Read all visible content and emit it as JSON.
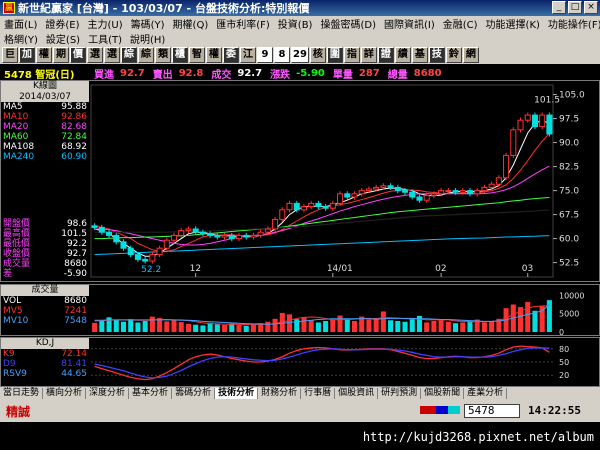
{
  "window": {
    "title": "新世紀贏家 [台灣] - 103/03/07 - 台盤技術分析:特別報價"
  },
  "menu": {
    "row1": [
      "畫面(L)",
      "證券(E)",
      "主力(U)",
      "籌碼(Y)",
      "期權(Q)",
      "匯市利率(F)",
      "投資(B)",
      "操盤密碼(D)",
      "國際資訊(I)",
      "金融(C)",
      "功能選擇(K)",
      "功能操作(F)"
    ],
    "row2": [
      "格網(Y)",
      "設定(S)",
      "工具(T)",
      "說明(H)"
    ]
  },
  "toolbar": [
    "巨",
    "加",
    "權",
    "期",
    "價",
    "選",
    "選",
    "綜",
    "綜",
    "類",
    "櫃",
    "智",
    "權",
    "委",
    "江",
    "9",
    "8",
    "29",
    "核",
    "圍",
    "指",
    "詳",
    "證",
    "績",
    "基",
    "技",
    "鈴",
    "網"
  ],
  "quote": {
    "code": "5478 智冠(日)",
    "buy_label": "買進",
    "buy_value": "92.7",
    "sell_label": "賣出",
    "sell_value": "92.8",
    "deal_label": "成交",
    "deal_value": "92.7",
    "change_label": "漲跌",
    "change_value": "-5.90",
    "volume_label": "單量",
    "volume_value": "287",
    "total_label": "總量",
    "total_value": "8680"
  },
  "kline_legend": {
    "title": "K線圖",
    "date": "2014/03/07",
    "ma": [
      {
        "name": "MA5",
        "value": "95.88"
      },
      {
        "name": "MA10",
        "value": "92.86"
      },
      {
        "name": "MA20",
        "value": "82.68"
      },
      {
        "name": "MA60",
        "value": "72.84"
      },
      {
        "name": "MA108",
        "value": "68.92"
      },
      {
        "name": "MA240",
        "value": "60.90"
      }
    ],
    "stats": [
      {
        "name": "開盤價",
        "value": "98.6"
      },
      {
        "name": "最高價",
        "value": "101.5"
      },
      {
        "name": "最低價",
        "value": "92.2"
      },
      {
        "name": "收盤價",
        "value": "92.7"
      },
      {
        "name": "成交量",
        "value": "8680"
      },
      {
        "name": "差",
        "value": "-5.90"
      }
    ]
  },
  "volume_legend": {
    "title": "成交量",
    "rows": [
      {
        "name": "VOL",
        "value": "8680"
      },
      {
        "name": "MV5",
        "value": "7241"
      },
      {
        "name": "MV10",
        "value": "7548"
      }
    ]
  },
  "kd_legend": {
    "title": "KD,J",
    "rows": [
      {
        "name": "K9",
        "value": "72.14"
      },
      {
        "name": "D9",
        "value": "81.41"
      },
      {
        "name": "RSV9",
        "value": "44.65"
      }
    ]
  },
  "bottom_tabs": [
    "當日走勢",
    "橫向分析",
    "深度分析",
    "基本分析",
    "籌碼分析",
    "技術分析",
    "財務分析",
    "行事曆",
    "個股資訊",
    "研判預測",
    "個股新聞",
    "產業分析"
  ],
  "status": {
    "mode": "精誠",
    "code": "5478",
    "clock": "14:22:55"
  },
  "url": "http://kujd3268.pixnet.net/album",
  "colors": {
    "up": "#ff3030",
    "down": "#00e0e0",
    "ma5": "#ffffff",
    "ma10": "#ff3030",
    "ma20": "#c040ff",
    "ma60": "#40ff40",
    "ma240": "#00c0ff",
    "k": "#ff3030",
    "d": "#4040ff"
  },
  "chart_data": [
    {
      "type": "candlestick",
      "title": "K線圖",
      "x_ticks": [
        "12",
        "14/01",
        "02",
        "03"
      ],
      "y_ticks": [
        105.0,
        97.5,
        90.0,
        82.5,
        75.0,
        67.5,
        60.0,
        52.5
      ],
      "ylim": [
        48,
        108
      ],
      "annotations": [
        {
          "label": "101.5"
        },
        {
          "label": "52.2"
        }
      ],
      "closes": [
        63.5,
        62,
        61,
        59,
        57,
        55,
        53.5,
        53,
        55,
        57,
        59.5,
        61,
        62.5,
        63,
        62,
        61.5,
        61,
        60.5,
        61,
        60,
        61,
        60.5,
        61,
        62,
        63,
        66,
        69,
        71,
        69,
        70,
        71,
        70,
        69.5,
        71,
        74,
        73,
        74,
        75,
        75.5,
        76,
        76.5,
        76,
        75,
        74.5,
        73,
        72,
        73.5,
        74,
        75,
        75,
        74.5,
        75,
        74,
        75,
        76,
        77,
        79,
        86,
        94,
        97,
        98.6,
        95,
        98.6,
        92.7
      ],
      "opens": [
        64,
        63.5,
        62,
        61,
        59,
        57,
        55,
        53.5,
        53,
        55,
        57,
        59.5,
        61,
        62.5,
        63,
        62,
        61.5,
        61,
        60.5,
        61,
        60,
        61,
        60.5,
        61,
        62,
        63,
        66,
        69,
        71,
        69,
        70,
        71,
        70,
        69.5,
        71,
        74,
        73,
        74,
        75,
        75.5,
        76,
        76.5,
        76,
        75,
        74.5,
        73,
        72,
        73.5,
        74,
        75,
        75,
        74.5,
        75,
        74,
        75,
        76,
        77,
        79,
        86,
        94,
        97,
        98.6,
        95,
        98.6
      ],
      "series": [
        {
          "name": "MA5",
          "values": [
            63,
            62.5,
            61.5,
            60,
            58.5,
            57,
            55.5,
            54.5,
            54.5,
            55.5,
            57,
            58.5,
            60,
            61.5,
            62,
            62,
            61.5,
            61,
            61,
            60.8,
            60.6,
            60.6,
            60.6,
            61,
            61.6,
            63,
            65,
            67.5,
            69,
            70,
            70,
            70.2,
            70,
            70.5,
            71.2,
            72,
            73,
            74,
            74.5,
            75,
            75.5,
            75.8,
            75.7,
            75.4,
            75,
            74,
            73.5,
            73.4,
            73.6,
            74.2,
            74.6,
            74.8,
            74.7,
            74.7,
            75,
            75.5,
            76.6,
            79,
            83,
            88,
            93,
            96,
            97,
            95.88
          ]
        },
        {
          "name": "MA10",
          "values": [
            64,
            63.5,
            63,
            62,
            61,
            60,
            58.5,
            57.5,
            56.5,
            56,
            56,
            56.5,
            57.5,
            58.5,
            59.5,
            60.5,
            61,
            61,
            61.2,
            61.2,
            61,
            60.8,
            60.8,
            61,
            61.2,
            61.8,
            62.8,
            64.2,
            65.5,
            66.8,
            68,
            69,
            69.8,
            70.2,
            70.6,
            71,
            71.6,
            72.2,
            72.8,
            73.5,
            74.2,
            74.8,
            75,
            75.2,
            75.2,
            75,
            74.6,
            74.4,
            74.2,
            74.1,
            74.1,
            74.2,
            74.2,
            74.3,
            74.6,
            75,
            75.7,
            76.8,
            78.8,
            81.4,
            84.4,
            87.6,
            90.4,
            92.86
          ]
        },
        {
          "name": "MA20",
          "values": [
            63,
            63,
            62.8,
            62.5,
            62,
            61.5,
            61,
            60.5,
            60,
            59.5,
            59,
            58.5,
            58.2,
            58,
            58,
            58.2,
            58.5,
            59,
            59.5,
            60,
            60.5,
            60.8,
            61,
            61.2,
            61.5,
            62,
            62.5,
            63.2,
            64,
            64.8,
            65.5,
            66.2,
            67,
            67.8,
            68.6,
            69.3,
            70,
            70.6,
            71.2,
            71.8,
            72.3,
            72.8,
            73.2,
            73.5,
            73.8,
            74,
            74,
            74,
            74,
            74,
            74,
            74,
            74,
            74,
            74.1,
            74.3,
            74.7,
            75.3,
            76.2,
            77.4,
            78.8,
            80.2,
            81.5,
            82.68
          ]
        },
        {
          "name": "MA60",
          "values": [
            60,
            60,
            60.1,
            60.2,
            60.3,
            60.3,
            60.4,
            60.5,
            60.5,
            60.6,
            60.7,
            60.8,
            60.9,
            61,
            61.2,
            61.4,
            61.6,
            61.8,
            62,
            62.2,
            62.4,
            62.6,
            62.8,
            63,
            63.2,
            63.4,
            63.6,
            63.9,
            64.2,
            64.5,
            64.8,
            65.1,
            65.4,
            65.7,
            66,
            66.3,
            66.6,
            66.9,
            67.2,
            67.5,
            67.8,
            68.1,
            68.4,
            68.6,
            68.8,
            69,
            69.2,
            69.4,
            69.6,
            69.8,
            70,
            70.2,
            70.4,
            70.6,
            70.8,
            71,
            71.2,
            71.5,
            71.8,
            72,
            72.3,
            72.5,
            72.7,
            72.84
          ]
        },
        {
          "name": "MA108",
          "values": [
            62,
            62,
            62,
            62,
            62,
            62,
            62,
            62,
            62,
            62,
            62,
            62.1,
            62.1,
            62.2,
            62.2,
            62.3,
            62.4,
            62.5,
            62.6,
            62.7,
            62.8,
            62.9,
            63,
            63.1,
            63.2,
            63.3,
            63.4,
            63.5,
            63.6,
            63.8,
            64,
            64.2,
            64.4,
            64.6,
            64.8,
            65,
            65.2,
            65.4,
            65.6,
            65.8,
            66,
            66.2,
            66.4,
            66.6,
            66.8,
            67,
            67.1,
            67.2,
            67.3,
            67.4,
            67.5,
            67.6,
            67.7,
            67.8,
            67.9,
            68,
            68.1,
            68.2,
            68.3,
            68.4,
            68.5,
            68.6,
            68.8,
            68.92
          ]
        },
        {
          "name": "MA240",
          "values": [
            55,
            55.1,
            55.2,
            55.3,
            55.4,
            55.5,
            55.6,
            55.7,
            55.8,
            55.9,
            56,
            56.1,
            56.2,
            56.3,
            56.4,
            56.5,
            56.6,
            56.7,
            56.8,
            56.9,
            57,
            57.1,
            57.2,
            57.3,
            57.4,
            57.5,
            57.6,
            57.7,
            57.8,
            57.9,
            58,
            58.1,
            58.2,
            58.3,
            58.4,
            58.5,
            58.6,
            58.7,
            58.8,
            58.9,
            59,
            59.1,
            59.2,
            59.3,
            59.4,
            59.5,
            59.6,
            59.7,
            59.8,
            59.9,
            60,
            60.05,
            60.1,
            60.15,
            60.2,
            60.3,
            60.4,
            60.5,
            60.55,
            60.6,
            60.7,
            60.75,
            60.85,
            60.9
          ]
        }
      ]
    },
    {
      "type": "bar",
      "title": "成交量",
      "y_ticks": [
        10000,
        5000,
        0
      ],
      "ylim": [
        0,
        12000
      ],
      "values": [
        2500,
        3000,
        4000,
        3200,
        2800,
        3500,
        2600,
        3000,
        4200,
        3800,
        2900,
        3300,
        2700,
        2200,
        2000,
        1800,
        2500,
        2100,
        1900,
        2300,
        2000,
        1700,
        1900,
        2400,
        2800,
        3600,
        5200,
        4800,
        3500,
        4000,
        3200,
        2600,
        3000,
        3400,
        4500,
        3600,
        3000,
        4200,
        3400,
        3800,
        5600,
        3200,
        3000,
        2800,
        3500,
        4400,
        2600,
        3000,
        3200,
        2800,
        2400,
        2600,
        3000,
        3400,
        2600,
        3000,
        3600,
        6500,
        7500,
        6800,
        8200,
        5800,
        7000,
        8680
      ],
      "series": [
        {
          "name": "MV5",
          "values": [
            3000,
            3100,
            3200,
            3300,
            3300,
            3300,
            3200,
            3200,
            3200,
            3400,
            3400,
            3300,
            3300,
            3100,
            2800,
            2500,
            2300,
            2200,
            2100,
            2100,
            2100,
            2000,
            2000,
            2000,
            2100,
            2300,
            2700,
            3200,
            3700,
            4000,
            4100,
            4000,
            3700,
            3300,
            3300,
            3400,
            3500,
            3700,
            3700,
            3600,
            3900,
            3900,
            3800,
            3600,
            3600,
            3500,
            3300,
            3300,
            3300,
            3300,
            3000,
            2900,
            2800,
            2800,
            2800,
            2900,
            3100,
            3800,
            4800,
            5600,
            6500,
            7000,
            7100,
            7241
          ]
        },
        {
          "name": "MV10",
          "values": [
            3200,
            3200,
            3300,
            3300,
            3300,
            3300,
            3300,
            3300,
            3300,
            3300,
            3300,
            3300,
            3200,
            3200,
            3100,
            2900,
            2800,
            2700,
            2600,
            2500,
            2400,
            2300,
            2200,
            2200,
            2100,
            2200,
            2400,
            2600,
            2800,
            3000,
            3200,
            3400,
            3500,
            3600,
            3600,
            3600,
            3600,
            3600,
            3600,
            3500,
            3600,
            3700,
            3700,
            3700,
            3700,
            3600,
            3600,
            3500,
            3400,
            3400,
            3300,
            3200,
            3100,
            3000,
            2900,
            2900,
            3000,
            3300,
            3800,
            4300,
            4800,
            5200,
            5800,
            7548
          ]
        }
      ]
    },
    {
      "type": "line",
      "title": "KD,J",
      "y_ticks": [
        80,
        50,
        20
      ],
      "ylim": [
        0,
        100
      ],
      "series": [
        {
          "name": "K9",
          "values": [
            40,
            35,
            30,
            25,
            20,
            15,
            12,
            10,
            12,
            18,
            26,
            35,
            45,
            55,
            62,
            66,
            68,
            66,
            62,
            58,
            55,
            52,
            50,
            50,
            52,
            56,
            62,
            70,
            76,
            80,
            82,
            83,
            82,
            80,
            78,
            77,
            78,
            79,
            80,
            80,
            80,
            78,
            74,
            70,
            65,
            60,
            58,
            58,
            60,
            62,
            63,
            62,
            60,
            60,
            62,
            65,
            70,
            78,
            84,
            86,
            85,
            84,
            82,
            72.14
          ]
        },
        {
          "name": "D9",
          "values": [
            45,
            42,
            38,
            34,
            30,
            25,
            20,
            16,
            14,
            15,
            18,
            24,
            31,
            39,
            46,
            53,
            58,
            61,
            62,
            61,
            59,
            57,
            55,
            54,
            53,
            54,
            57,
            61,
            66,
            71,
            75,
            78,
            79,
            80,
            79,
            78,
            78,
            78,
            79,
            79,
            79,
            79,
            77,
            75,
            72,
            68,
            65,
            62,
            61,
            61,
            62,
            62,
            61,
            61,
            61,
            62,
            65,
            69,
            74,
            78,
            81,
            82,
            82,
            81.41
          ]
        }
      ]
    }
  ]
}
